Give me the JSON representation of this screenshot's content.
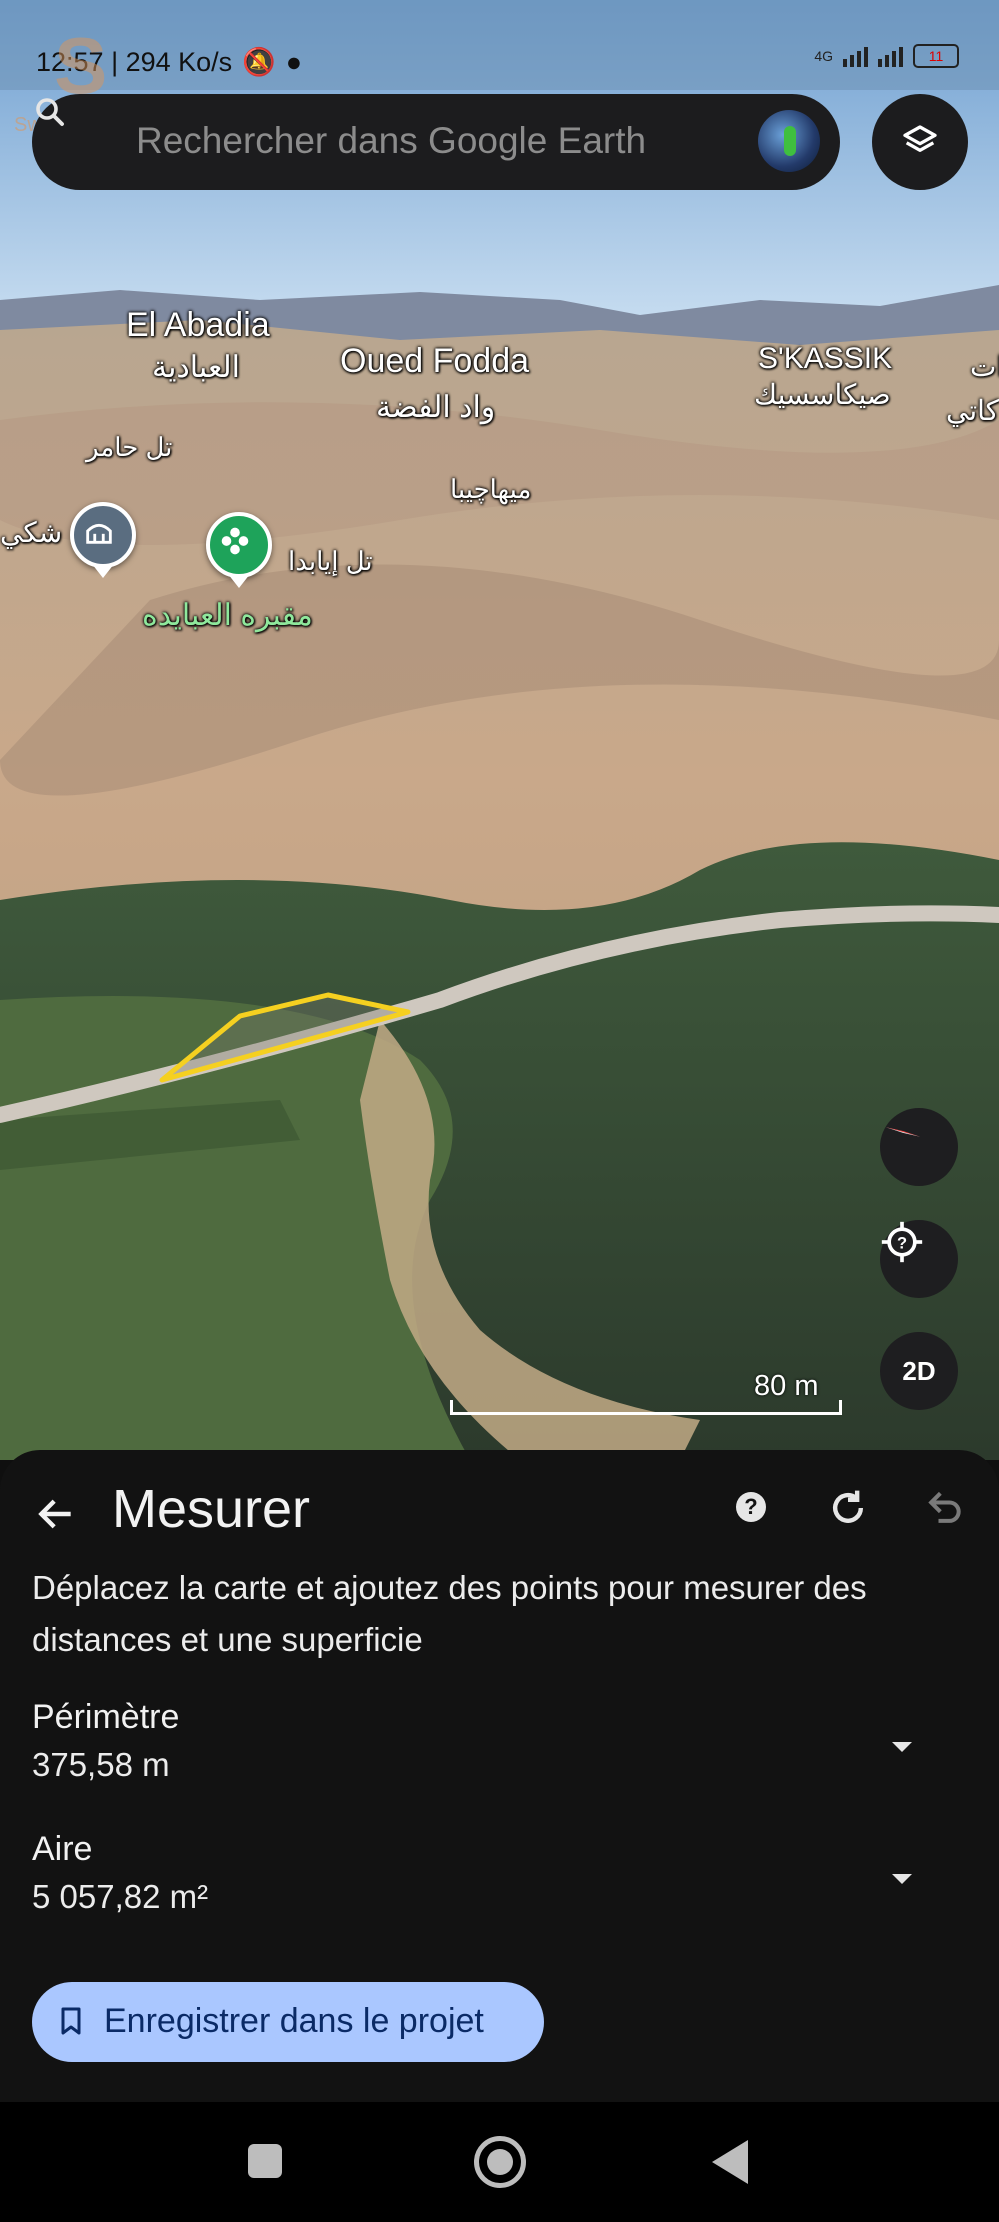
{
  "status_bar": {
    "time_speed": "12:57 | 294 Ko/s",
    "network": "4G",
    "battery": "11"
  },
  "watermark": {
    "text": "Swiga | سويقة"
  },
  "search": {
    "placeholder": "Rechercher dans Google Earth"
  },
  "map": {
    "places": {
      "el_abadia_fr": "El Abadia",
      "el_abadia_ar": "العبادية",
      "oued_fodda_fr": "Oued Fodda",
      "oued_fodda_ar": "واد الفضة",
      "skassik_fr": "S'KASSIK",
      "skassik_ar": "صيكاسسيك",
      "tel_hamer": "تل حامر",
      "mihachiba": "ميهاچيبا",
      "tel_ibaida": "تل إيابدا",
      "cemetery": "مقبره العبايده",
      "shaki": "شكي",
      "kati": "كاتي",
      "edge_t": "ات"
    },
    "buttons": {
      "mode_2d": "2D"
    },
    "scale": {
      "label": "80 m"
    },
    "measure_outline_color": "#f5d020"
  },
  "panel": {
    "title": "Mesurer",
    "instruction": "Déplacez la carte et ajoutez des points pour mesurer des distances et une superficie",
    "perimeter": {
      "label": "Périmètre",
      "value": "375,58 m"
    },
    "area": {
      "label": "Aire",
      "value": "5 057,82 m²"
    },
    "save_label": "Enregistrer dans le projet"
  },
  "colors": {
    "accent": "#aac7ff",
    "panel_bg": "#121212"
  }
}
